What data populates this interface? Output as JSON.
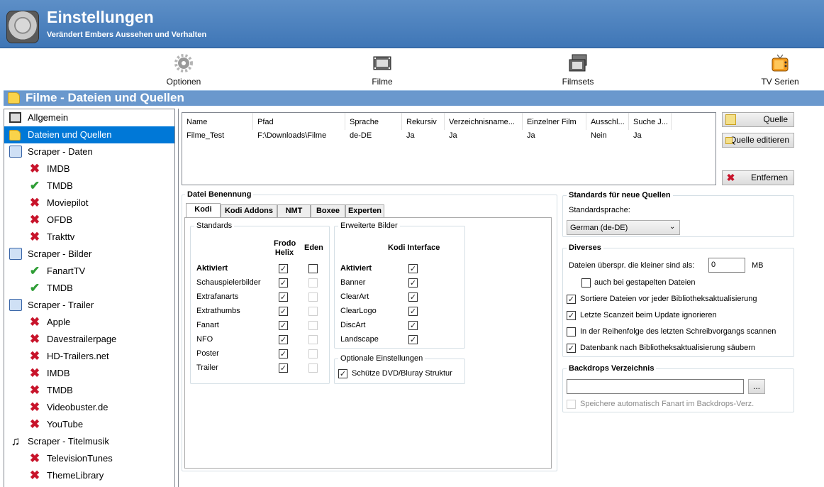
{
  "header": {
    "title": "Einstellungen",
    "subtitle": "Verändert Embers Aussehen und Verhalten"
  },
  "toolbar": [
    {
      "label": "Optionen",
      "icon": "gear-icon"
    },
    {
      "label": "Filme",
      "icon": "film-icon"
    },
    {
      "label": "Filmsets",
      "icon": "filmsets-icon"
    },
    {
      "label": "TV Serien",
      "icon": "tv-icon"
    }
  ],
  "section": {
    "title": "Filme - Dateien und Quellen"
  },
  "sidebar": {
    "items": [
      {
        "label": "Allgemein",
        "icon": "film-icon",
        "indent": 0
      },
      {
        "label": "Dateien und Quellen",
        "icon": "folder-icon",
        "indent": 0,
        "selected": true
      },
      {
        "label": "Scraper - Daten",
        "icon": "scraper-data-icon",
        "indent": 0
      },
      {
        "label": "IMDB",
        "icon": "x-icon",
        "indent": 1
      },
      {
        "label": "TMDB",
        "icon": "check-icon",
        "indent": 1
      },
      {
        "label": "Moviepilot",
        "icon": "x-icon",
        "indent": 1
      },
      {
        "label": "OFDB",
        "icon": "x-icon",
        "indent": 1
      },
      {
        "label": "Trakttv",
        "icon": "x-icon",
        "indent": 1
      },
      {
        "label": "Scraper - Bilder",
        "icon": "scraper-images-icon",
        "indent": 0
      },
      {
        "label": "FanartTV",
        "icon": "check-icon",
        "indent": 1
      },
      {
        "label": "TMDB",
        "icon": "check-icon",
        "indent": 1
      },
      {
        "label": "Scraper - Trailer",
        "icon": "scraper-trailer-icon",
        "indent": 0
      },
      {
        "label": "Apple",
        "icon": "x-icon",
        "indent": 1
      },
      {
        "label": "Davestrailerpage",
        "icon": "x-icon",
        "indent": 1
      },
      {
        "label": "HD-Trailers.net",
        "icon": "x-icon",
        "indent": 1
      },
      {
        "label": "IMDB",
        "icon": "x-icon",
        "indent": 1
      },
      {
        "label": "TMDB",
        "icon": "x-icon",
        "indent": 1
      },
      {
        "label": "Videobuster.de",
        "icon": "x-icon",
        "indent": 1
      },
      {
        "label": "YouTube",
        "icon": "x-icon",
        "indent": 1
      },
      {
        "label": "Scraper - Titelmusik",
        "icon": "music-icon",
        "indent": 0
      },
      {
        "label": "TelevisionTunes",
        "icon": "x-icon",
        "indent": 1
      },
      {
        "label": "ThemeLibrary",
        "icon": "x-icon",
        "indent": 1
      }
    ]
  },
  "sources": {
    "columns": [
      "Name",
      "Pfad",
      "Sprache",
      "Rekursiv",
      "Verzeichnisname...",
      "Einzelner Film",
      "Ausschl...",
      "Suche J..."
    ],
    "rows": [
      [
        "Filme_Test",
        "F:\\Downloads\\Filme",
        "de-DE",
        "Ja",
        "Ja",
        "Ja",
        "Nein",
        "Ja"
      ]
    ]
  },
  "buttons": {
    "add": "Quelle",
    "edit": "Quelle editieren",
    "remove": "Entfernen"
  },
  "naming": {
    "title": "Datei Benennung",
    "tabs": [
      "Kodi",
      "Kodi Addons",
      "NMT",
      "Boxee",
      "Experten"
    ],
    "standards": {
      "title": "Standards",
      "col1": "Frodo\nHelix",
      "col1a": "Frodo",
      "col1b": "Helix",
      "col2": "Eden",
      "rows": [
        {
          "label": "Aktiviert",
          "bold": true,
          "frodo": true,
          "eden": false,
          "eden_enabled": true
        },
        {
          "label": "Schauspielerbilder",
          "frodo": true,
          "eden": false,
          "eden_enabled": false
        },
        {
          "label": "Extrafanarts",
          "frodo": true,
          "eden": false,
          "eden_enabled": false
        },
        {
          "label": "Extrathumbs",
          "frodo": true,
          "eden": false,
          "eden_enabled": false
        },
        {
          "label": "Fanart",
          "frodo": true,
          "eden": false,
          "eden_enabled": false
        },
        {
          "label": "NFO",
          "frodo": true,
          "eden": false,
          "eden_enabled": false
        },
        {
          "label": "Poster",
          "frodo": true,
          "eden": false,
          "eden_enabled": false
        },
        {
          "label": "Trailer",
          "frodo": true,
          "eden": false,
          "eden_enabled": false
        }
      ]
    },
    "extended": {
      "title": "Erweiterte Bilder",
      "col": "Kodi Interface",
      "rows": [
        {
          "label": "Aktiviert",
          "bold": true,
          "checked": true
        },
        {
          "label": "Banner",
          "checked": true
        },
        {
          "label": "ClearArt",
          "checked": true
        },
        {
          "label": "ClearLogo",
          "checked": true
        },
        {
          "label": "DiscArt",
          "checked": true
        },
        {
          "label": "Landscape",
          "checked": true
        }
      ]
    },
    "optional": {
      "title": "Optionale Einstellungen",
      "label": "Schütze DVD/Bluray Struktur",
      "checked": true
    }
  },
  "defaults": {
    "title": "Standards für neue Quellen",
    "lang_label": "Standardsprache:",
    "lang_value": "German (de-DE)"
  },
  "misc": {
    "title": "Diverses",
    "skip_label": "Dateien überspr. die kleiner sind als:",
    "skip_value": "0",
    "unit": "MB",
    "stacked_label": "auch bei gestapelten Dateien",
    "stacked": false,
    "options": [
      {
        "label": "Sortiere Dateien vor jeder Bibliotheksaktualisierung",
        "checked": true
      },
      {
        "label": "Letzte Scanzeit beim Update ignorieren",
        "checked": true
      },
      {
        "label": "In der Reihenfolge des letzten Schreibvorgangs scannen",
        "checked": false
      },
      {
        "label": "Datenbank nach Bibliotheksaktualisierung säubern",
        "checked": true
      }
    ]
  },
  "backdrops": {
    "title": "Backdrops Verzeichnis",
    "path": "",
    "browse": "...",
    "auto_label": "Speichere automatisch Fanart im Backdrops-Verz.",
    "auto": false
  }
}
